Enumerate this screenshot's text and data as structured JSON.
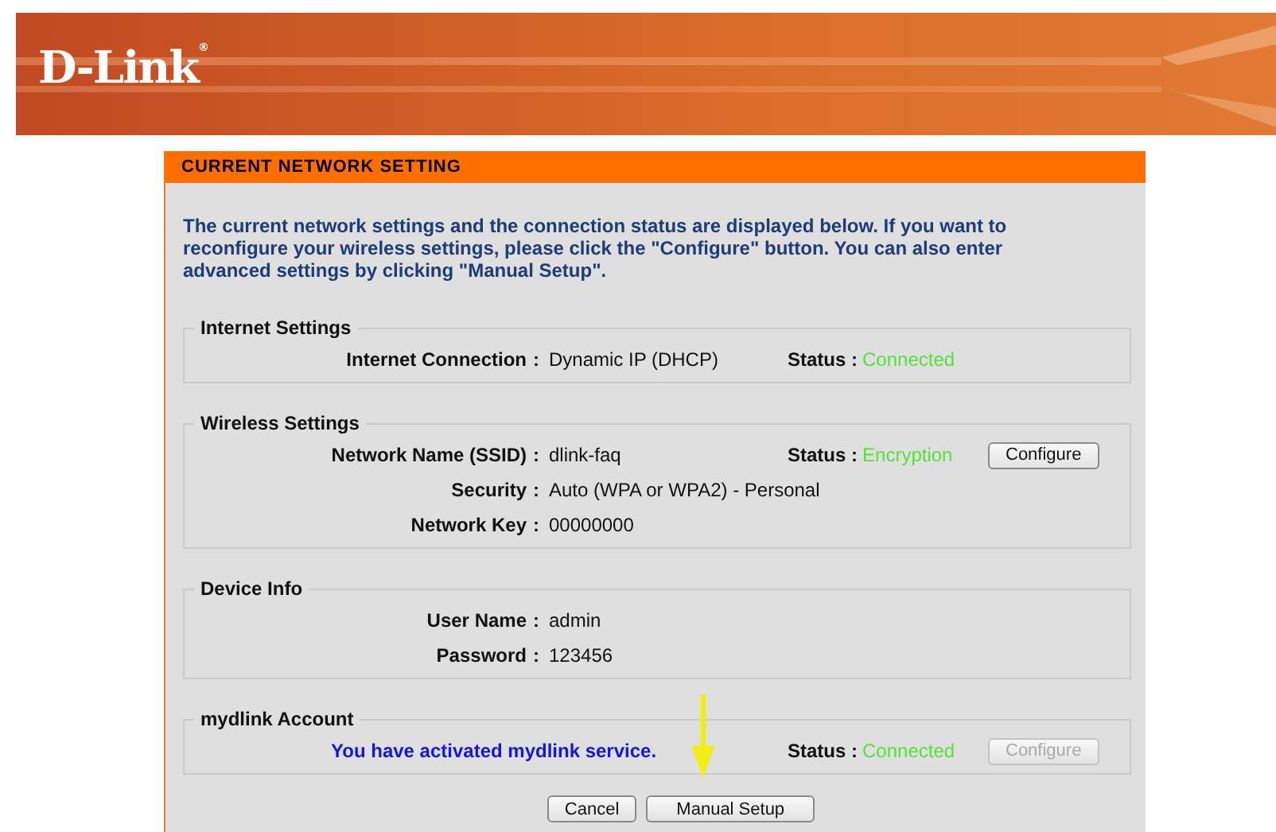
{
  "banner": {
    "logo": "D-Link",
    "logo_mark": "®"
  },
  "panel": {
    "title": "CURRENT NETWORK SETTING",
    "intro": "The current network settings and the connection status are displayed below. If you want to reconfigure your wireless settings, please click the \"Configure\" button. You can also enter advanced settings by clicking \"Manual Setup\".",
    "sections": [
      {
        "title": "Internet Settings",
        "rows": [
          {
            "kind": "field",
            "label": "Internet Connection",
            "separator": ":",
            "value": "Dynamic IP (DHCP)",
            "status": {
              "label": "Status :",
              "value": "Connected"
            }
          }
        ]
      },
      {
        "title": "Wireless Settings",
        "rows": [
          {
            "kind": "field",
            "label": "Network Name (SSID)",
            "separator": ":",
            "value": "dlink-faq",
            "status": {
              "label": "Status :",
              "value": "Encryption"
            },
            "button": {
              "label": "Configure",
              "disabled": false
            }
          },
          {
            "kind": "field",
            "label": "Security",
            "separator": ":",
            "value": "Auto (WPA or WPA2) - Personal"
          },
          {
            "kind": "field",
            "label": "Network Key",
            "separator": ":",
            "value": "00000000"
          }
        ]
      },
      {
        "title": "Device Info",
        "rows": [
          {
            "kind": "field",
            "label": "User Name",
            "separator": ":",
            "value": "admin"
          },
          {
            "kind": "field",
            "label": "Password",
            "separator": ":",
            "value": "123456"
          }
        ]
      },
      {
        "title": "mydlink Account",
        "rows": [
          {
            "kind": "message",
            "text": "You have activated mydlink service.",
            "status": {
              "label": "Status :",
              "value": "Connected"
            },
            "button": {
              "label": "Configure",
              "disabled": true
            }
          }
        ]
      }
    ],
    "buttons": [
      "Cancel",
      "Manual Setup"
    ]
  }
}
